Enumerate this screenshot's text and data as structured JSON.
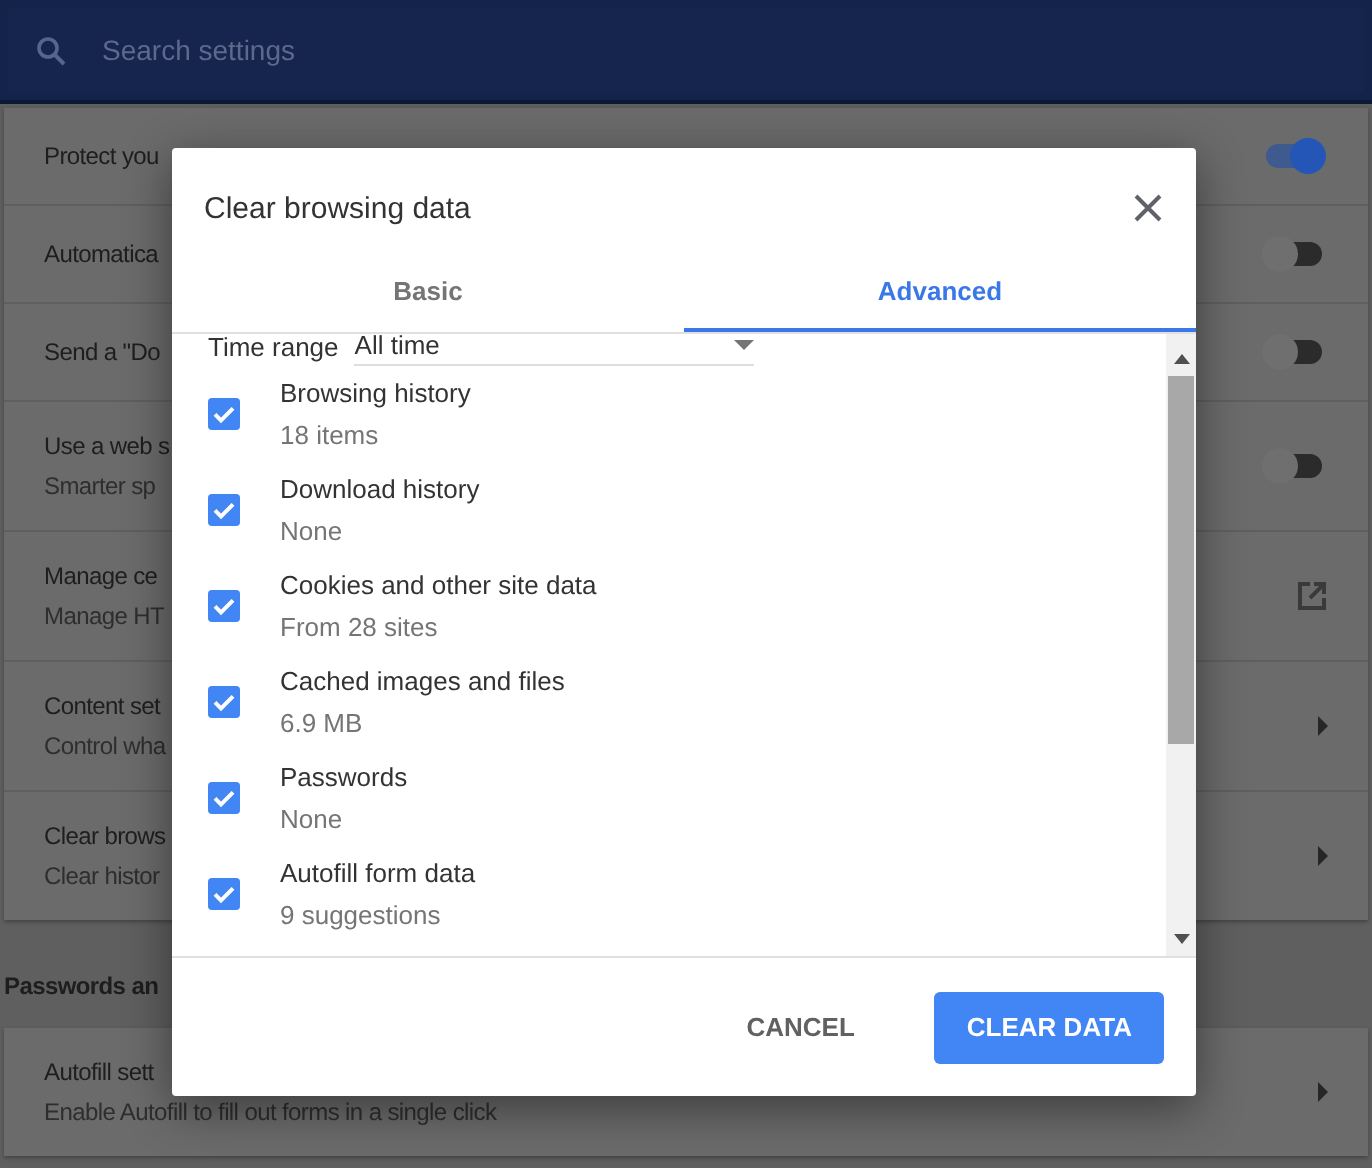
{
  "search": {
    "placeholder": "Search settings"
  },
  "settings_rows": [
    {
      "title": "Protect you",
      "kind": "toggle",
      "on": true
    },
    {
      "title": "Automatica",
      "kind": "toggle",
      "on": false
    },
    {
      "title": "Send a \"Do",
      "kind": "toggle",
      "on": false
    },
    {
      "title": "Use a web s",
      "subtitle": "Smarter sp",
      "kind": "toggle",
      "on": false
    },
    {
      "title": "Manage ce",
      "subtitle": "Manage HT",
      "kind": "external"
    },
    {
      "title": "Content set",
      "subtitle": "Control wha",
      "kind": "arrow"
    },
    {
      "title": "Clear brows",
      "subtitle": "Clear histor",
      "kind": "arrow"
    }
  ],
  "section_heading": "Passwords an",
  "autofill_rows": [
    {
      "title": "Autofill sett",
      "subtitle": "Enable Autofill to fill out forms in a single click",
      "kind": "arrow"
    }
  ],
  "dialog": {
    "title": "Clear browsing data",
    "tabs": [
      {
        "label": "Basic",
        "selected": false
      },
      {
        "label": "Advanced",
        "selected": true
      }
    ],
    "time_range": {
      "label": "Time range",
      "value": "All time"
    },
    "items": [
      {
        "title": "Browsing history",
        "detail": "18 items",
        "checked": true
      },
      {
        "title": "Download history",
        "detail": "None",
        "checked": true
      },
      {
        "title": "Cookies and other site data",
        "detail": "From 28 sites",
        "checked": true
      },
      {
        "title": "Cached images and files",
        "detail": "6.9 MB",
        "checked": true
      },
      {
        "title": "Passwords",
        "detail": "None",
        "checked": true
      },
      {
        "title": "Autofill form data",
        "detail": "9 suggestions",
        "checked": true
      }
    ],
    "buttons": [
      {
        "label": "CANCEL",
        "kind": "text"
      },
      {
        "label": "CLEAR DATA",
        "kind": "primary"
      }
    ]
  }
}
